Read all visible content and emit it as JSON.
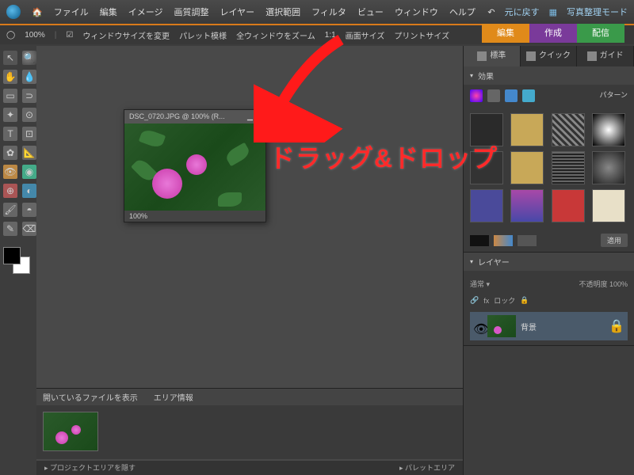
{
  "menubar": {
    "items": [
      "ファイル",
      "編集",
      "イメージ",
      "画質調整",
      "レイヤー",
      "選択範囲",
      "フィルタ",
      "ビュー",
      "ウィンドウ",
      "ヘルプ"
    ],
    "undo": "元に戻す",
    "mode": "写真整理モード"
  },
  "toolbar": {
    "zoomPct": "100%",
    "fitWindow": "ウィンドウサイズを変更",
    "palette": "パレット模様",
    "allWindows": "全ウィンドウをズーム",
    "oneToOne": "1:1",
    "screenSize": "画面サイズ",
    "printSize": "プリントサイズ"
  },
  "tabs": {
    "edit": "編集",
    "make": "作成",
    "share": "配信"
  },
  "rightTabs": {
    "standard": "標準",
    "quick": "クイック",
    "guided": "ガイド"
  },
  "effects": {
    "title": "効果",
    "dropdown": "パターン",
    "apply": "適用"
  },
  "layers": {
    "title": "レイヤー",
    "opacityLabel": "不透明度",
    "opacityVal": "100%",
    "lock": "ロック",
    "layerName": "背景"
  },
  "document": {
    "title": "DSC_0720.JPG @ 100% (R...",
    "zoomStatus": "100%"
  },
  "projectBin": {
    "tab1": "開いているファイルを表示",
    "tab2": "エリア情報"
  },
  "statusbar": {
    "left": "▸ プロジェクトエリアを隠す",
    "right": "▸ パレットエリア"
  },
  "annotation": "ドラッグ&ドロップ"
}
